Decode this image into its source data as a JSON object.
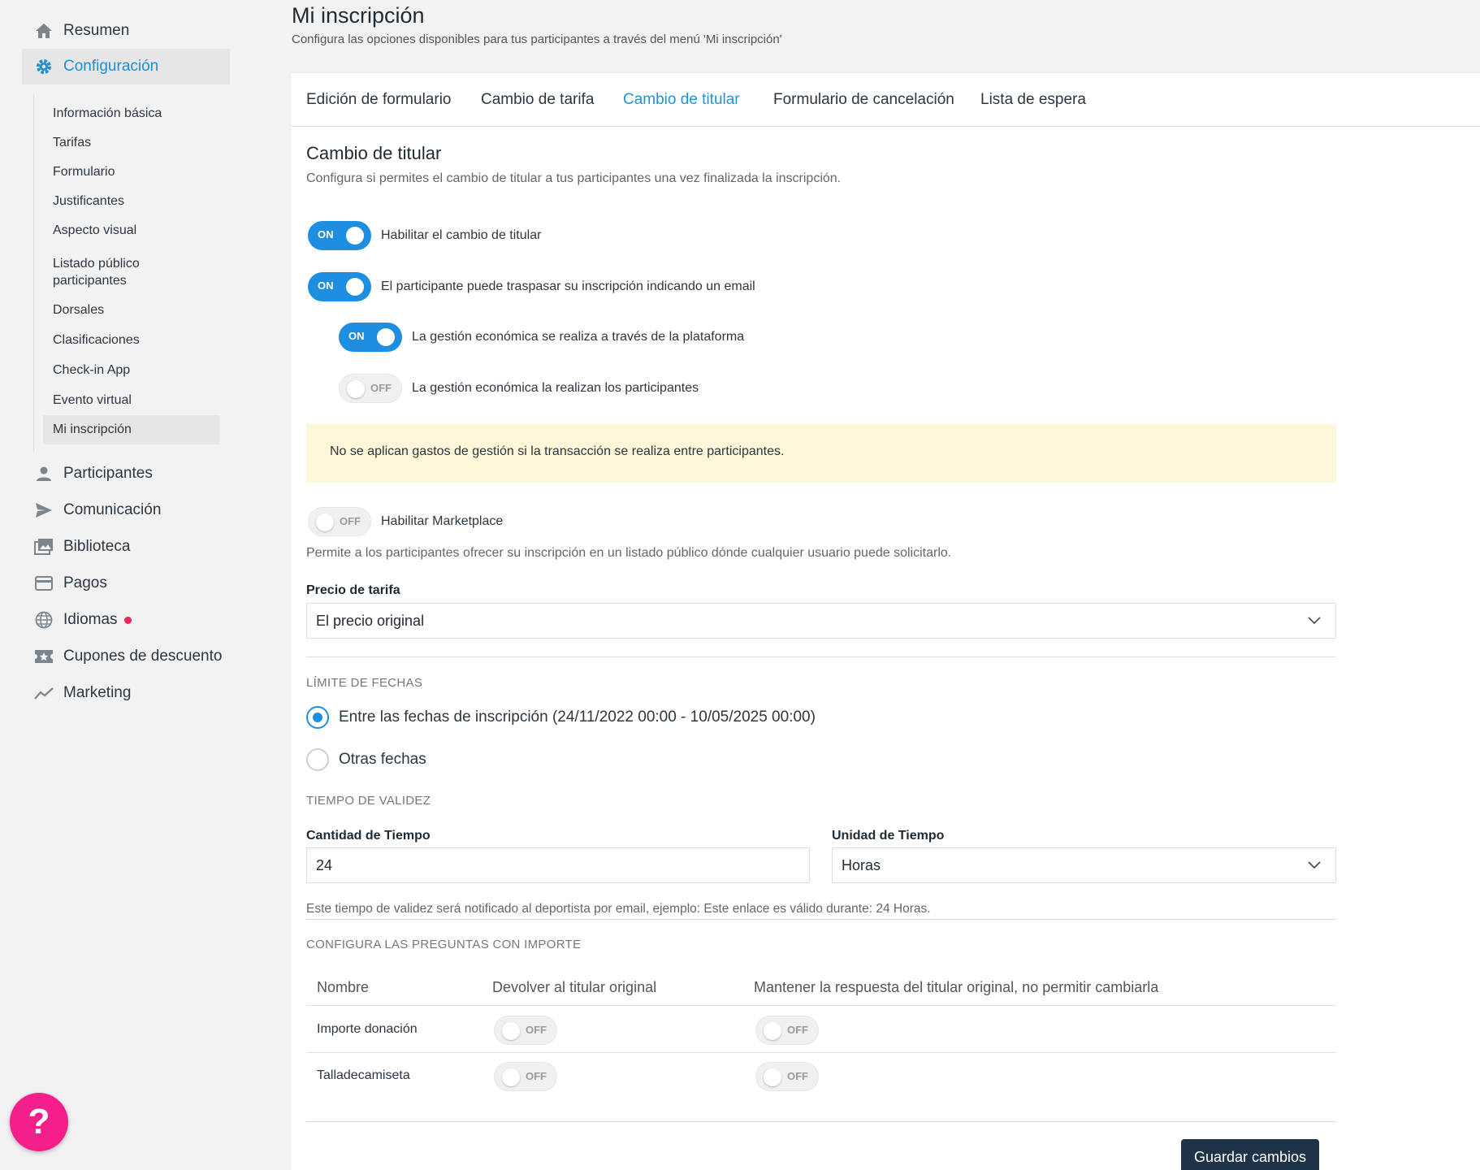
{
  "sidebar": {
    "resumen": "Resumen",
    "configuracion": "Configuración",
    "sub_items": [
      "Información básica",
      "Tarifas",
      "Formulario",
      "Justificantes",
      "Aspecto visual",
      "Listado público",
      "participantes",
      "Dorsales",
      "Clasificaciones",
      "Check-in App",
      "Evento virtual",
      "Mi inscripción"
    ],
    "participantes": "Participantes",
    "comunicacion": "Comunicación",
    "biblioteca": "Biblioteca",
    "pagos": "Pagos",
    "idiomas": "Idiomas",
    "cupones": "Cupones de descuento",
    "marketing": "Marketing"
  },
  "help": {
    "label": "?"
  },
  "header": {
    "title": "Mi inscripción",
    "subtitle": "Configura las opciones disponibles para tus participantes a través del menú 'Mi inscripción'"
  },
  "tabs": [
    "Edición de formulario",
    "Cambio de tarifa",
    "Cambio de titular",
    "Formulario de cancelación",
    "Lista de espera"
  ],
  "section": {
    "title": "Cambio de titular",
    "subtitle": "Configura si permites el cambio de titular a tus participantes una vez finalizada la inscripción."
  },
  "toggles": {
    "on_label": "ON",
    "off_label": "OFF",
    "habilitar_label": "Habilitar el cambio de titular",
    "email_label": "El participante puede traspasar su inscripción indicando un email",
    "plataforma_label": "La gestión económica se realiza a través de la plataforma",
    "participantes_label": "La gestión económica la realizan los participantes",
    "marketplace_label": "Habilitar Marketplace"
  },
  "notice": "No se aplican gastos de gestión si la transacción se realiza entre participantes.",
  "marketplace_desc": "Permite a los participantes ofrecer su inscripción en un listado público dónde cualquier usuario puede solicitarlo.",
  "precio": {
    "label": "Precio de tarifa",
    "value": "El precio original"
  },
  "limite": {
    "heading": "LÍMITE DE FECHAS",
    "option1": "Entre las fechas de inscripción (24/11/2022 00:00 - 10/05/2025 00:00)",
    "option2": "Otras fechas"
  },
  "validez": {
    "heading": "TIEMPO DE VALIDEZ",
    "cantidad_label": "Cantidad de Tiempo",
    "cantidad_value": "24",
    "unidad_label": "Unidad de Tiempo",
    "unidad_value": "Horas",
    "note": "Este tiempo de validez será notificado al deportista por email, ejemplo: Este enlace es válido durante: 24 Horas."
  },
  "preguntas": {
    "heading": "CONFIGURA LAS PREGUNTAS CON IMPORTE",
    "columns": [
      "Nombre",
      "Devolver al titular original",
      "Mantener la respuesta del titular original, no permitir cambiarla"
    ],
    "rows": [
      {
        "name": "Importe donación"
      },
      {
        "name": "Talladecamiseta"
      }
    ]
  },
  "save_label": "Guardar cambios",
  "colors": {
    "accent": "#1e8fe0",
    "notice_bg": "#fdf6d8",
    "button": "#1e3347",
    "help": "#f51f8c"
  }
}
